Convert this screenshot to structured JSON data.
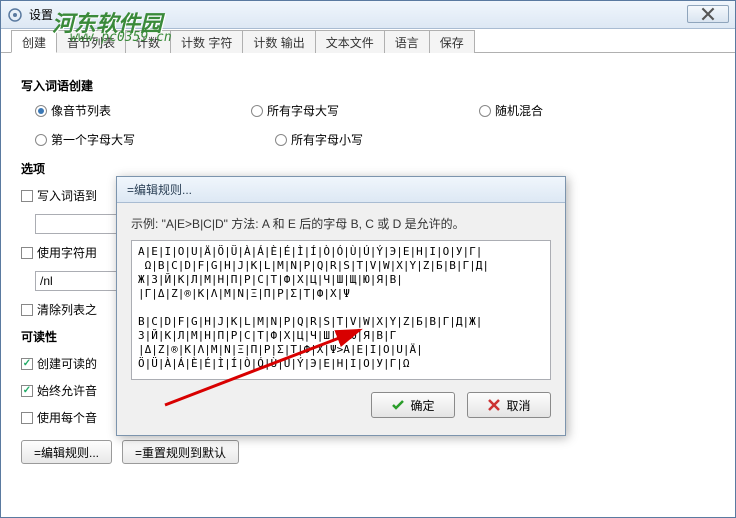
{
  "window": {
    "title": "设置"
  },
  "watermark": {
    "main": "河东软件园",
    "sub": "www.pc0359.cn"
  },
  "tabs": [
    "创建",
    "音节列表",
    "计数",
    "计数 字符",
    "计数 输出",
    "文本文件",
    "语言",
    "保存"
  ],
  "section1": {
    "title": "写入词语创建",
    "radios": {
      "r1": "像音节列表",
      "r2": "所有字母大写",
      "r3": "随机混合",
      "r4": "第一个字母大写",
      "r5": "所有字母小写"
    }
  },
  "section2": {
    "title": "选项",
    "c1": "写入词语到",
    "c2": "使用字符用",
    "inputValue": "/nl",
    "c3": "清除列表之"
  },
  "section3": {
    "title": "可读性",
    "c1": "创建可读的",
    "c2": "始终允许音",
    "c3": "使用每个音"
  },
  "buttons": {
    "edit": "=编辑规则...",
    "reset": "=重置规则到默认"
  },
  "modal": {
    "title": "=编辑规则...",
    "example": "示例: \"A|E>B|C|D\" 方法: A 和 E 后的字母 B, C 或 D 是允许的。",
    "rules": "A|E|I|O|U|Ä|Ö|Ü|À|Á|È|É|Ì|Í|Ò|Ó|Ù|Ú|Ý|Э|Е|Н|I|О|У|Г|\n Ω|B|C|D|F|G|H|J|K|L|M|N|P|Q|R|S|T|V|W|X|Y|Z|Б|В|Г|Д|\nЖ|З|Й|К|Л|М|Н|П|Р|С|Т|Ф|Х|Ц|Ч|Ш|Щ|Ю|Я|В|\n|Г|Δ|Z|®|K|Λ|M|N|Ξ|Π|Р|Σ|T|Ф|X|Ψ\n\nB|C|D|F|G|H|J|K|L|M|N|P|Q|R|S|T|V|W|X|Y|Z|Б|В|Г|Д|Ж|\nЗ|Й|К|Л|М|Н|П|Р|С|Т|Ф|X|Ц|Ч|Ш|Щ|Ю|Я|В|Г\n|Δ|Z|®|K|Λ|M|N|Ξ|Π|Р|Σ|T|Ф|X|Ψ>A|E|I|O|U|Ä|\nÖ|Ü|À|Á|È|É|Ì|Í|Ò|Ó|Ù|Ú|Ý|Э|Е|Н|I|О|У|Г|Ω",
    "ok": "确定",
    "cancel": "取消"
  }
}
